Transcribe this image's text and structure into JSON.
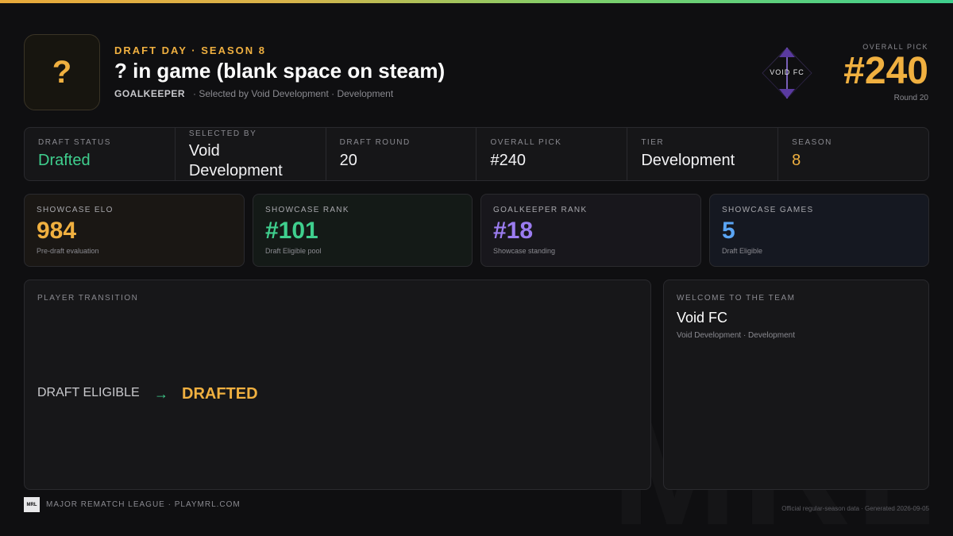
{
  "header": {
    "avatar_glyph": "?",
    "eyebrow": "DRAFT DAY · SEASON 8",
    "player_name": "? in game (blank space on steam)",
    "position": "GOALKEEPER",
    "selection_line": "· Selected by Void Development · Development",
    "team_crest": "VOID FC",
    "crest_icon": "void-fc-crest-icon",
    "pick_label": "OVERALL PICK",
    "pick_number": "#240",
    "round_label": "Round 20"
  },
  "info": [
    {
      "label": "DRAFT STATUS",
      "value": "Drafted"
    },
    {
      "label": "SELECTED BY",
      "value": "Void Development"
    },
    {
      "label": "DRAFT ROUND",
      "value": "20"
    },
    {
      "label": "OVERALL PICK",
      "value": "#240"
    },
    {
      "label": "TIER",
      "value": "Development"
    },
    {
      "label": "SEASON",
      "value": "8"
    }
  ],
  "stats": [
    {
      "label": "SHOWCASE ELO",
      "value": "984",
      "note": "Pre-draft evaluation"
    },
    {
      "label": "SHOWCASE RANK",
      "value": "#101",
      "note": "Draft Eligible pool"
    },
    {
      "label": "GOALKEEPER RANK",
      "value": "#18",
      "note": "Showcase standing"
    },
    {
      "label": "SHOWCASE GAMES",
      "value": "5",
      "note": "Draft Eligible"
    }
  ],
  "transition": {
    "label": "PLAYER TRANSITION",
    "from": "DRAFT ELIGIBLE",
    "arrow": "→",
    "to": "DRAFTED"
  },
  "welcome": {
    "label": "WELCOME TO THE TEAM",
    "team_name": "Void FC",
    "team_sub": "Void Development · Development"
  },
  "footer": {
    "logo": "MRL",
    "league": "MAJOR REMATCH LEAGUE · PLAYMRL.COM",
    "generated": "Official regular-season data · Generated 2026-09-05",
    "watermark": "MRL"
  },
  "colors": {
    "accent": "#f0b040",
    "green": "#3fcf8e",
    "purple": "#9b7cf0",
    "blue": "#5aa5f5",
    "background": "#0f0f11"
  }
}
